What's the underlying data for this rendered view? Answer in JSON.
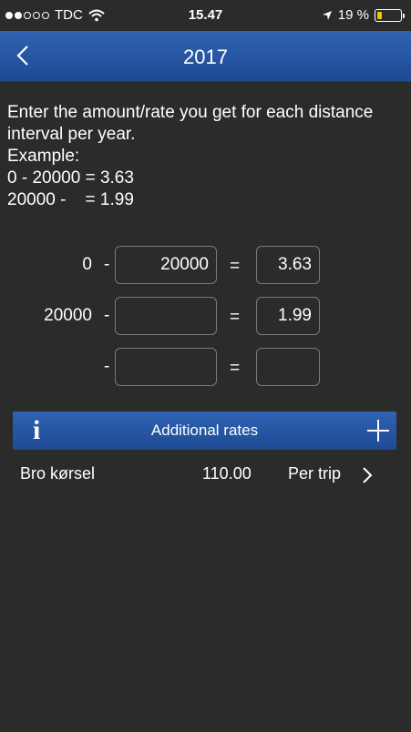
{
  "status": {
    "carrier": "TDC",
    "time": "15.47",
    "battery_text": "19 %",
    "battery_level": 0.19
  },
  "nav": {
    "title": "2017",
    "back_icon": "chevron-left-icon"
  },
  "intro": {
    "line1": "Enter the amount/rate you get for each distance interval per year.",
    "line2": "Example:",
    "line3": "0 - 20000 = 3.63",
    "line4": "20000 -    = 1.99"
  },
  "rates": [
    {
      "from": "0",
      "to": "20000",
      "rate": "3.63"
    },
    {
      "from": "20000",
      "to": "",
      "rate": "1.99"
    },
    {
      "from": "",
      "to": "",
      "rate": ""
    }
  ],
  "symbols": {
    "dash": "-",
    "equals": "="
  },
  "additional": {
    "info_label": "i",
    "title": "Additional rates",
    "items": [
      {
        "name": "Bro kørsel",
        "amount": "110.00",
        "unit": "Per trip"
      }
    ]
  },
  "colors": {
    "background": "#2b2b2b",
    "bar_blue": "#2a5aa8",
    "battery": "#f5c400"
  }
}
